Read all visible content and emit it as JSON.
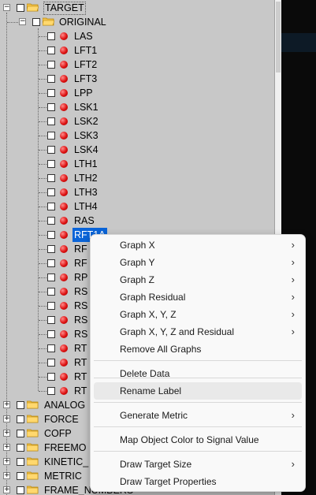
{
  "tree": {
    "root": {
      "label": "TARGET",
      "expander": "−"
    },
    "original": {
      "label": "ORIGINAL",
      "expander": "−"
    },
    "markers": [
      "LAS",
      "LFT1",
      "LFT2",
      "LFT3",
      "LPP",
      "LSK1",
      "LSK2",
      "LSK3",
      "LSK4",
      "LTH1",
      "LTH2",
      "LTH3",
      "LTH4",
      "RAS",
      "RFT1A",
      "RF",
      "RF",
      "RP",
      "RS",
      "RS",
      "RS",
      "RS",
      "RT",
      "RT",
      "RT",
      "RT"
    ],
    "selected_marker": "RFT1A",
    "groups": [
      {
        "label": "ANALOG",
        "expander": "+"
      },
      {
        "label": "FORCE",
        "expander": "+"
      },
      {
        "label": "COFP",
        "expander": "+"
      },
      {
        "label": "FREEMO",
        "expander": "+"
      },
      {
        "label": "KINETIC_",
        "expander": "+"
      },
      {
        "label": "METRIC",
        "expander": "+"
      },
      {
        "label": "FRAME_NUMBERS",
        "expander": "+"
      }
    ]
  },
  "context_menu": {
    "items": [
      {
        "label": "Graph X",
        "submenu": true
      },
      {
        "label": "Graph Y",
        "submenu": true
      },
      {
        "label": "Graph Z",
        "submenu": true
      },
      {
        "label": "Graph Residual",
        "submenu": true
      },
      {
        "label": "Graph X, Y, Z",
        "submenu": true
      },
      {
        "label": "Graph X, Y, Z and Residual",
        "submenu": true
      },
      {
        "label": "Remove All Graphs",
        "submenu": false
      },
      {
        "label": "Delete Data",
        "submenu": false
      },
      {
        "label": "Rename Label",
        "submenu": false,
        "hovered": true
      },
      {
        "label": "Generate Metric",
        "submenu": true
      },
      {
        "label": "Map Object Color to Signal Value",
        "submenu": false
      },
      {
        "label": "Draw Target Size",
        "submenu": true
      },
      {
        "label": "Draw Target Properties",
        "submenu": false
      }
    ],
    "submenu_arrow": "›"
  },
  "colors": {
    "tree_bg": "#c8c8c8",
    "selection": "#0a64d8",
    "marker": "#dd1111",
    "folder": "#f3c24a",
    "menu_bg": "#f9f9f9"
  }
}
